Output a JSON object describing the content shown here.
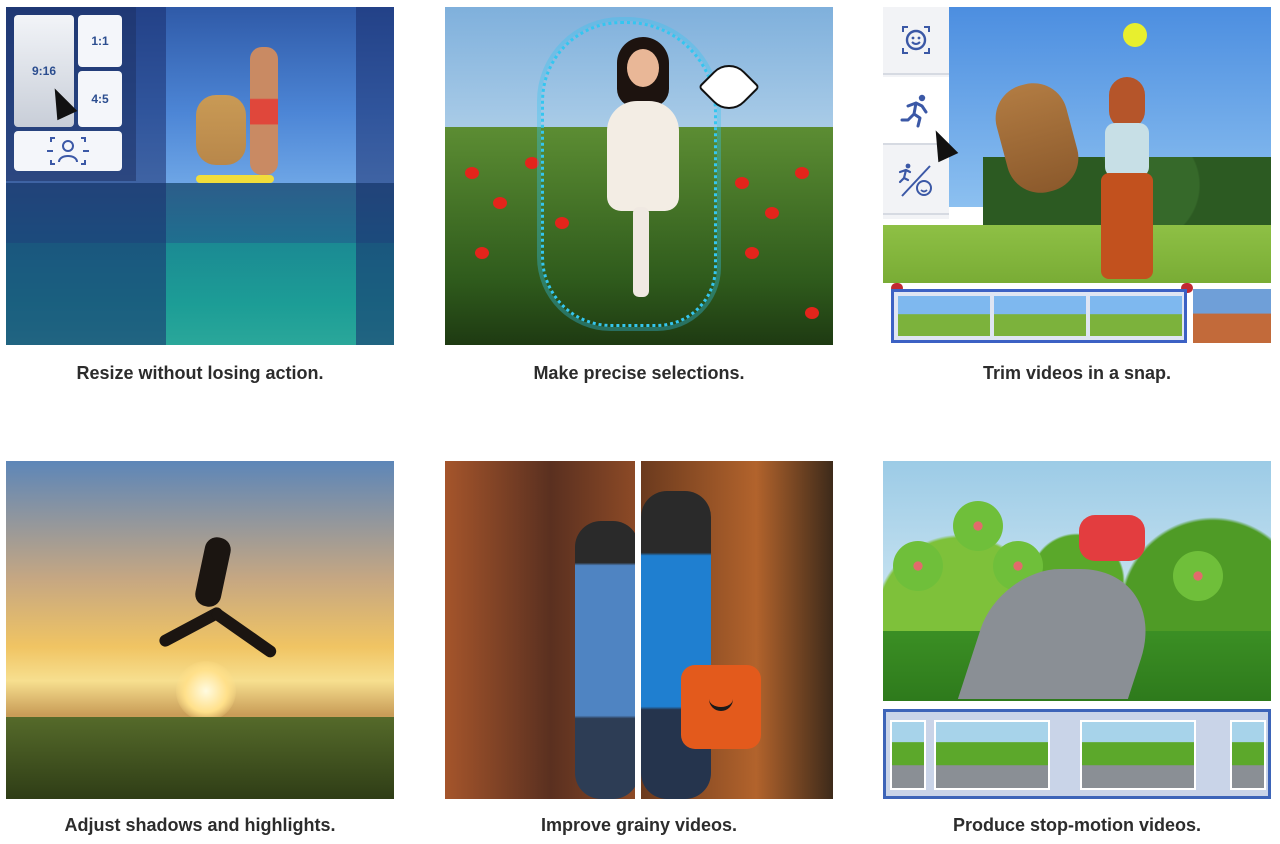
{
  "cards": [
    {
      "caption": "Resize without losing action.",
      "ratio_options": [
        "9:16",
        "1:1",
        "4:5"
      ],
      "selected_ratio": "9:16"
    },
    {
      "caption": "Make precise selections."
    },
    {
      "caption": "Trim videos in a snap."
    },
    {
      "caption": "Adjust shadows and highlights."
    },
    {
      "caption": "Improve grainy videos."
    },
    {
      "caption": "Produce stop-motion videos."
    }
  ]
}
